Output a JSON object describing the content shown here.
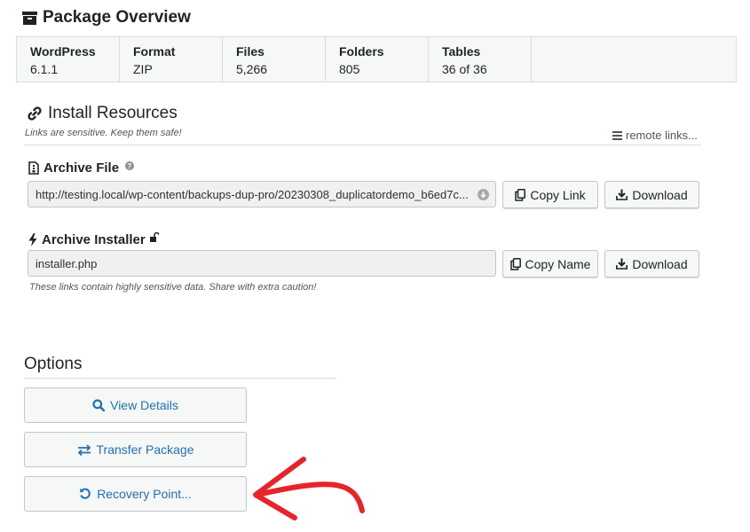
{
  "overview": {
    "title": "Package Overview",
    "cells": [
      {
        "key": "WordPress",
        "value": "6.1.1"
      },
      {
        "key": "Format",
        "value": "ZIP"
      },
      {
        "key": "Files",
        "value": "5,266"
      },
      {
        "key": "Folders",
        "value": "805"
      },
      {
        "key": "Tables",
        "value": "36 of 36"
      }
    ]
  },
  "install": {
    "title": "Install Resources",
    "note": "Links are sensitive. Keep them safe!",
    "remote_links": "remote links...",
    "archive": {
      "title": "Archive File",
      "url": "http://testing.local/wp-content/backups-dup-pro/20230308_duplicatordemo_b6ed7c...",
      "copy_label": "Copy Link",
      "download_label": "Download"
    },
    "installer": {
      "title": "Archive Installer",
      "filename": "installer.php",
      "copy_label": "Copy Name",
      "download_label": "Download"
    },
    "warning": "These links contain highly sensitive data. Share with extra caution!"
  },
  "options": {
    "title": "Options",
    "view_details": "View Details",
    "transfer": "Transfer Package",
    "recovery": "Recovery Point..."
  },
  "colors": {
    "link_blue": "#2271b1",
    "arrow_red": "#e8232a"
  }
}
